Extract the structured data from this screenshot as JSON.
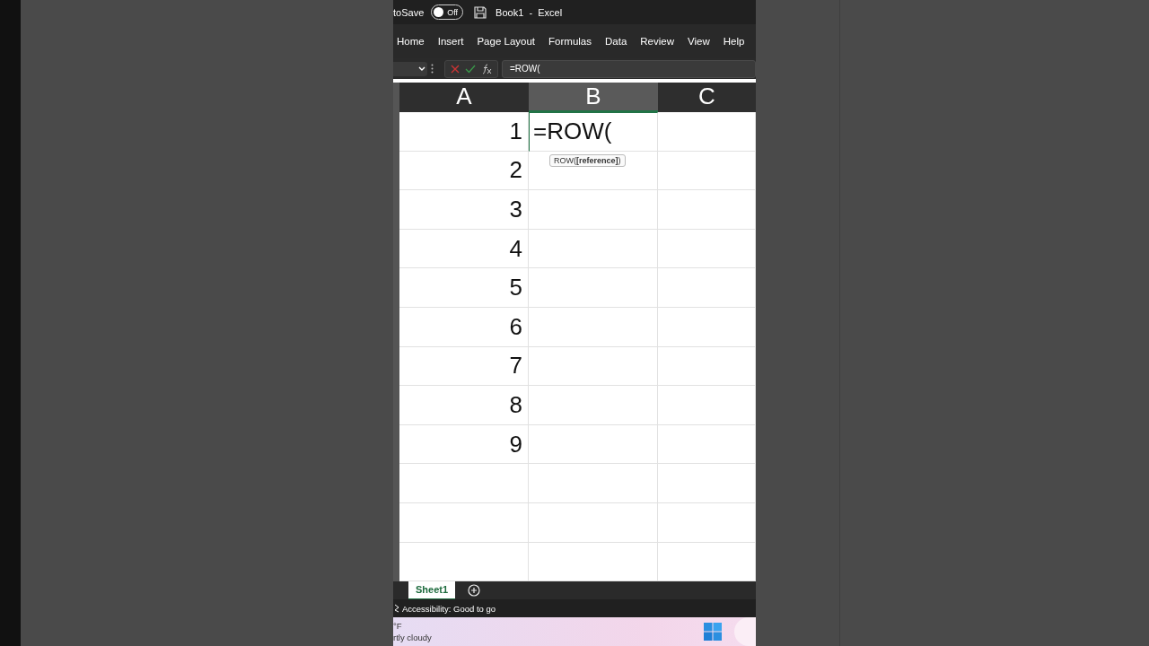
{
  "title_bar": {
    "autosave_label": "toSave",
    "autosave_toggle": {
      "label": "Off",
      "on": false
    },
    "title": "Book1  -  Excel"
  },
  "ribbon_tabs": [
    "Home",
    "Insert",
    "Page Layout",
    "Formulas",
    "Data",
    "Review",
    "View",
    "Help"
  ],
  "formula_bar": {
    "formula": "=ROW("
  },
  "columns": [
    {
      "label": "A",
      "selected": false
    },
    {
      "label": "B",
      "selected": true
    },
    {
      "label": "C",
      "selected": false
    }
  ],
  "rows": [
    {
      "a": "1",
      "b": "=ROW(",
      "editing": true,
      "tooltip": "ROW(**[reference]**)"
    },
    {
      "a": "2",
      "editing": false
    },
    {
      "a": "3",
      "editing": false
    },
    {
      "a": "4",
      "editing": false
    },
    {
      "a": "5",
      "editing": false
    },
    {
      "a": "6",
      "editing": false
    },
    {
      "a": "7",
      "editing": false
    },
    {
      "a": "8",
      "editing": false
    },
    {
      "a": "9",
      "editing": false
    }
  ],
  "sheet_tabs": [
    {
      "label": "Sheet1",
      "selected": true
    }
  ],
  "status_bar": {
    "text": "Accessibility: Good to go"
  },
  "taskbar": {
    "weather_temp": "°F",
    "weather_text": "rtly cloudy"
  }
}
